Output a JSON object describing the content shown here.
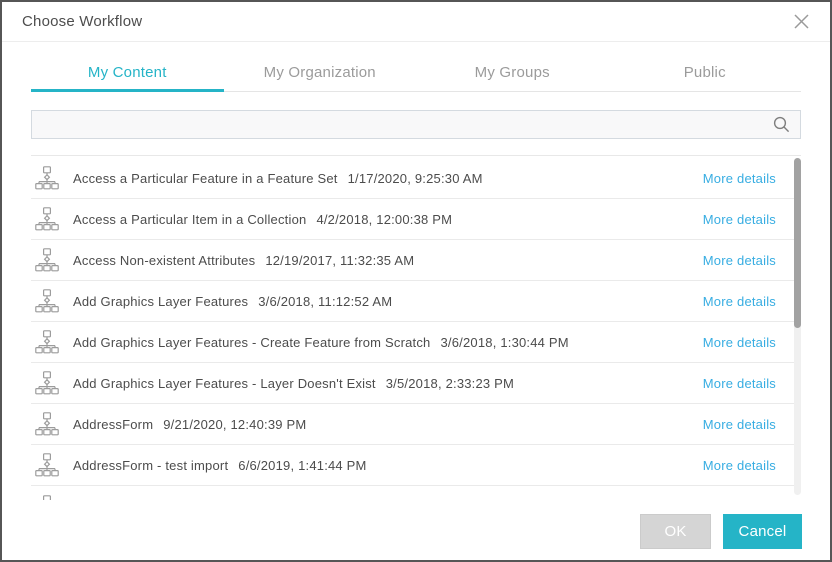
{
  "colors": {
    "accent": "#25b4c7",
    "link": "#37ade2",
    "okbg": "#d5d5d5"
  },
  "dialog": {
    "title": "Choose Workflow"
  },
  "tabs": {
    "items": [
      {
        "label": "My Content",
        "active": true
      },
      {
        "label": "My Organization",
        "active": false
      },
      {
        "label": "My Groups",
        "active": false
      },
      {
        "label": "Public",
        "active": false
      }
    ]
  },
  "search": {
    "value": "",
    "placeholder": ""
  },
  "list": {
    "more_details_label": "More details",
    "items": [
      {
        "name": "Access a Particular Feature in a Feature Set",
        "timestamp": "1/17/2020, 9:25:30 AM"
      },
      {
        "name": "Access a Particular Item in a Collection",
        "timestamp": "4/2/2018, 12:00:38 PM"
      },
      {
        "name": "Access Non-existent Attributes",
        "timestamp": "12/19/2017, 11:32:35 AM"
      },
      {
        "name": "Add Graphics Layer Features",
        "timestamp": "3/6/2018, 11:12:52 AM"
      },
      {
        "name": "Add Graphics Layer Features - Create Feature from Scratch",
        "timestamp": "3/6/2018, 1:30:44 PM"
      },
      {
        "name": "Add Graphics Layer Features - Layer Doesn't Exist",
        "timestamp": "3/5/2018, 2:33:23 PM"
      },
      {
        "name": "AddressForm",
        "timestamp": "9/21/2020, 12:40:39 PM"
      },
      {
        "name": "AddressForm - test import",
        "timestamp": "6/6/2019, 1:41:44 PM"
      }
    ]
  },
  "footer": {
    "ok_label": "OK",
    "cancel_label": "Cancel"
  }
}
